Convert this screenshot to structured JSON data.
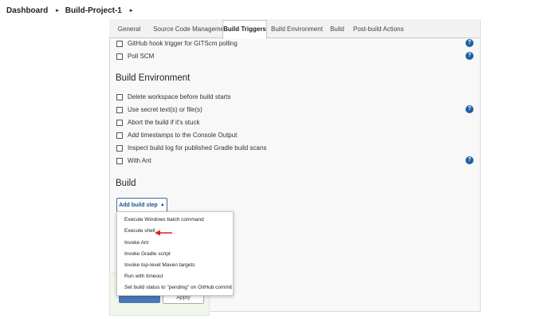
{
  "breadcrumb": {
    "items": [
      "Dashboard",
      "Build-Project-1"
    ],
    "separator": "▸"
  },
  "tabs": [
    {
      "label": "General",
      "active": false
    },
    {
      "label": "Source Code Management",
      "active": false
    },
    {
      "label": "Build Triggers",
      "active": true
    },
    {
      "label": "Build Environment",
      "active": false
    },
    {
      "label": "Build",
      "active": false
    },
    {
      "label": "Post-build Actions",
      "active": false
    }
  ],
  "build_triggers": {
    "options": [
      {
        "label": "GitHub hook trigger for GITScm polling",
        "checked": false,
        "help": true
      },
      {
        "label": "Poll SCM",
        "checked": false,
        "help": true
      }
    ]
  },
  "build_environment": {
    "title": "Build Environment",
    "options": [
      {
        "label": "Delete workspace before build starts",
        "checked": false,
        "help": false
      },
      {
        "label": "Use secret text(s) or file(s)",
        "checked": false,
        "help": true
      },
      {
        "label": "Abort the build if it's stuck",
        "checked": false,
        "help": false
      },
      {
        "label": "Add timestamps to the Console Output",
        "checked": false,
        "help": false
      },
      {
        "label": "Inspect build log for published Gradle build scans",
        "checked": false,
        "help": false
      },
      {
        "label": "With Ant",
        "checked": false,
        "help": true
      }
    ]
  },
  "build": {
    "title": "Build",
    "add_step_label": "Add build step",
    "add_step_caret": "▲",
    "menu_items": [
      "Execute Windows batch command",
      "Execute shell",
      "Invoke Ant",
      "Invoke Gradle script",
      "Invoke top-level Maven targets",
      "Run with timeout",
      "Set build status to \"pending\" on GitHub commit"
    ]
  },
  "footer": {
    "save_label": "",
    "apply_label": "Apply"
  },
  "help_icon_glyph": "?",
  "colors": {
    "accent_blue": "#1c5fa3",
    "annotation_arrow": "#d9261c"
  }
}
